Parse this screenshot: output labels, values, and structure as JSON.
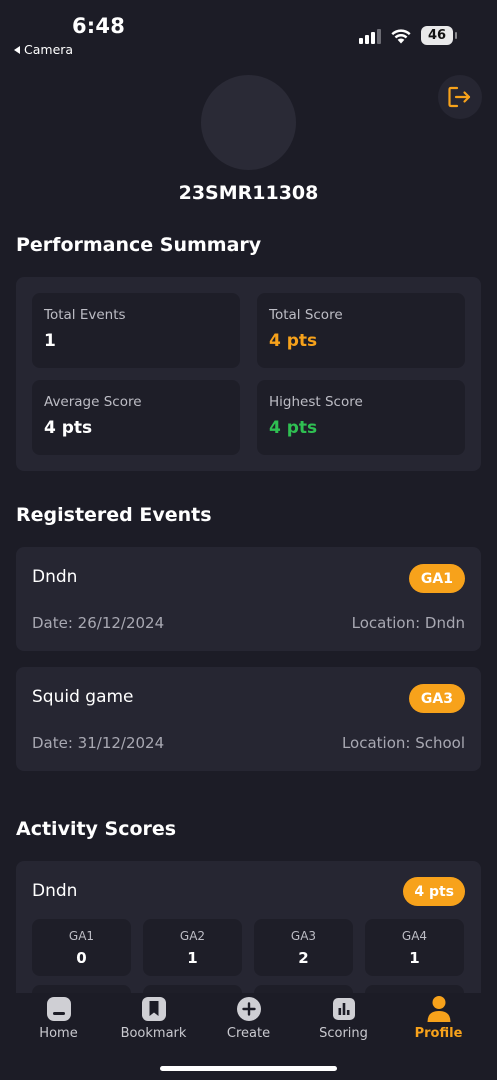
{
  "status_bar": {
    "time": "6:48",
    "back_app": "Camera",
    "battery": "46"
  },
  "profile": {
    "username": "23SMR11308"
  },
  "performance": {
    "title": "Performance Summary",
    "stats": [
      {
        "label": "Total Events",
        "value": "1"
      },
      {
        "label": "Total Score",
        "value": "4 pts"
      },
      {
        "label": "Average Score",
        "value": "4 pts"
      },
      {
        "label": "Highest Score",
        "value": "4 pts"
      }
    ]
  },
  "registered_events": {
    "title": "Registered Events",
    "items": [
      {
        "name": "Dndn",
        "badge": "GA1",
        "date": "Date: 26/12/2024",
        "location": "Location: Dndn"
      },
      {
        "name": "Squid game",
        "badge": "GA3",
        "date": "Date: 31/12/2024",
        "location": "Location: School"
      }
    ]
  },
  "activity_scores": {
    "title": "Activity Scores",
    "items": [
      {
        "name": "Dndn",
        "badge": "4 pts",
        "scores": [
          {
            "label": "GA1",
            "value": "0"
          },
          {
            "label": "GA2",
            "value": "1"
          },
          {
            "label": "GA3",
            "value": "2"
          },
          {
            "label": "GA4",
            "value": "1"
          }
        ]
      }
    ]
  },
  "bottom_nav": {
    "items": [
      {
        "label": "Home",
        "icon": "home-icon"
      },
      {
        "label": "Bookmark",
        "icon": "bookmark-icon"
      },
      {
        "label": "Create",
        "icon": "plus-circle-icon"
      },
      {
        "label": "Scoring",
        "icon": "bar-chart-icon"
      },
      {
        "label": "Profile",
        "icon": "person-icon",
        "active": true
      }
    ]
  },
  "colors": {
    "background": "#1c1c26",
    "card": "#262632",
    "accent": "#f7a21b",
    "success": "#2fbf52"
  }
}
